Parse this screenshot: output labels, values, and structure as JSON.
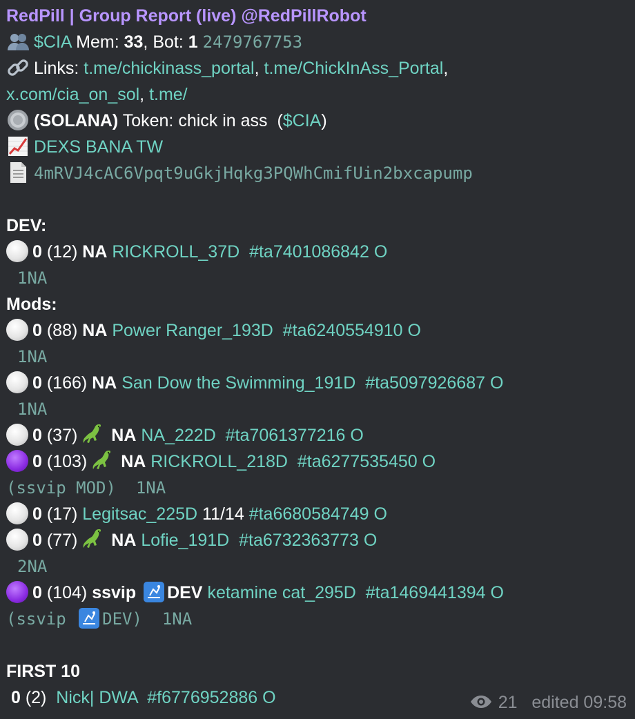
{
  "header": {
    "title": "RedPill | Group Report (live) @RedPillRobot"
  },
  "members": {
    "ticker": "$CIA",
    "mem_label": "Mem:",
    "mem_count": "33",
    "bot_label": ", Bot:",
    "bot_count": "1",
    "group_id": "2479767753"
  },
  "links": {
    "label": "Links:",
    "items": [
      "t.me/chickinass_portal",
      "t.me/ChickInAss_Portal",
      "x.com/cia_on_sol",
      "t.me/"
    ]
  },
  "token": {
    "chain": "(SOLANA)",
    "label": "Token: chick in ass",
    "ticker": "($CIA)",
    "ticker_open": "(",
    "ticker_link": "$CIA",
    "ticker_close": ")",
    "chart_links": "DEXS BANA TW",
    "contract": "4mRVJ4cAC6Vpqt9uGkjHqkg3PQWhCmifUin2bxcapump"
  },
  "dev_section": {
    "heading": "DEV:",
    "entry": {
      "score": "0",
      "count": "(12)",
      "tag": "NA",
      "name": "RICKROLL_37D",
      "id": "#ta7401086842",
      "suffix": "O",
      "sub": "1NA"
    }
  },
  "mods_section": {
    "heading": "Mods:",
    "entries": [
      {
        "dot": "white",
        "score": "0",
        "count": "(88)",
        "tag": "NA",
        "name": "Power Ranger_193D",
        "id": "#ta6240554910",
        "suffix": "O",
        "sub": "1NA"
      },
      {
        "dot": "white",
        "score": "0",
        "count": "(166)",
        "tag": "NA",
        "name": "San Dow the Swimming_191D",
        "id": "#ta5097926687",
        "suffix": "O",
        "sub": "1NA"
      },
      {
        "dot": "white",
        "score": "0",
        "count": "(37)",
        "tag": "NA",
        "name": "NA_222D",
        "id": "#ta7061377216",
        "suffix": "O"
      },
      {
        "dot": "purple",
        "score": "0",
        "count": "(103)",
        "tag": "NA",
        "name": "RICKROLL_218D",
        "id": "#ta6277535450",
        "suffix": "O",
        "sub": "(ssvip MOD)  1NA"
      },
      {
        "dot": "white",
        "score": "0",
        "count": "(17)",
        "name": "Legitsac_225D",
        "extra": "11/14",
        "id": "#ta6680584749",
        "suffix": "O"
      },
      {
        "dot": "white",
        "score": "0",
        "count": "(77)",
        "tag": "NA",
        "name": "Lofie_191D",
        "id": "#ta6732363773",
        "suffix": "O",
        "sub": "2NA"
      },
      {
        "dot": "purple",
        "score": "0",
        "count": "(104)",
        "tag": "ssvip",
        "tag2": "DEV",
        "name": "ketamine cat_295D",
        "id": "#ta1469441394",
        "suffix": "O",
        "sub_a": "(ssvip ",
        "sub_b": "DEV)  1NA"
      }
    ]
  },
  "first10": {
    "heading": "FIRST 10",
    "entry": {
      "score": "0",
      "count": "(2)",
      "name": "Nick| DWA",
      "id": "#f6776952886",
      "suffix": "O"
    }
  },
  "footer": {
    "views": "21",
    "edited": "edited 09:58"
  },
  "icons": {
    "members": "people-icon",
    "links": "link-icon",
    "coin": "coin-icon",
    "chart": "chart-increasing-icon",
    "document": "document-icon",
    "lizard": "lizard-icon",
    "badge": "dev-badge-icon",
    "views": "eye-icon"
  },
  "colors": {
    "background": "#2b2d31",
    "title": "#b895ff",
    "link": "#6fd3c3",
    "text": "#ffffff",
    "muted": "#8a8d93"
  }
}
